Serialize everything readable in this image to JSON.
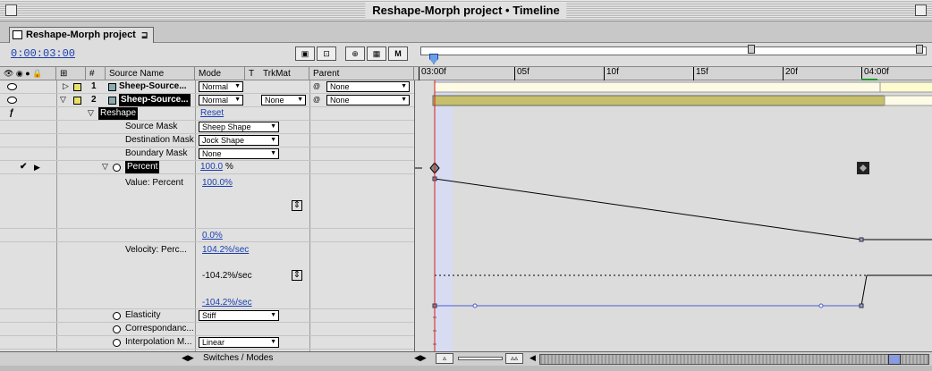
{
  "window": {
    "title": "Reshape-Morph project • Timeline"
  },
  "tab": {
    "label": "Reshape-Morph project",
    "menu": "⊒"
  },
  "toolbar": {
    "timecode": "0:00:03:00",
    "buttons": [
      "▣",
      "⊡",
      "⊕",
      "▦",
      "M"
    ]
  },
  "columns": {
    "hash": "#",
    "source_name": "Source Name",
    "mode": "Mode",
    "t": "T",
    "trkmat": "TrkMat",
    "parent": "Parent"
  },
  "ruler": {
    "labels": [
      "03:00f",
      "05f",
      "10f",
      "15f",
      "20f",
      "04:00f"
    ]
  },
  "layers": [
    {
      "num": "1",
      "name": "Sheep-Source...",
      "mode": "Normal",
      "trkmat": "",
      "parent": "None",
      "color": "#e8e06a"
    },
    {
      "num": "2",
      "name": "Sheep-Source...",
      "mode": "Normal",
      "trkmat": "None",
      "parent": "None",
      "color": "#e8e06a"
    }
  ],
  "effect": {
    "name": "Reshape",
    "reset": "Reset"
  },
  "props": {
    "source_mask": {
      "label": "Source Mask",
      "value": "Sheep Shape"
    },
    "destination_mask": {
      "label": "Destination Mask",
      "value": "Jock Shape"
    },
    "boundary_mask": {
      "label": "Boundary Mask",
      "value": "None"
    },
    "percent": {
      "label": "Percent",
      "value": "100.0",
      "unit": "%"
    },
    "value_percent": {
      "label": "Value: Percent",
      "top": "100.0%",
      "bottom": "0.0%"
    },
    "velocity": {
      "label": "Velocity: Perc...",
      "top": "104.2%/sec",
      "mid": "-104.2%/sec",
      "bottom": "-104.2%/sec"
    },
    "elasticity": {
      "label": "Elasticity",
      "value": "Stiff"
    },
    "correspondence": {
      "label": "Correspondanc..."
    },
    "interpolation": {
      "label": "Interpolation M...",
      "value": "Linear"
    }
  },
  "bottom_bar": {
    "label": "Switches / Modes"
  },
  "colors": {
    "timecode": "#1a3fb0",
    "graph_line": "#000000",
    "velocity_line": "#4a5fcf",
    "current_time": "#d81e1e",
    "work_area": "#c6bf6b"
  }
}
